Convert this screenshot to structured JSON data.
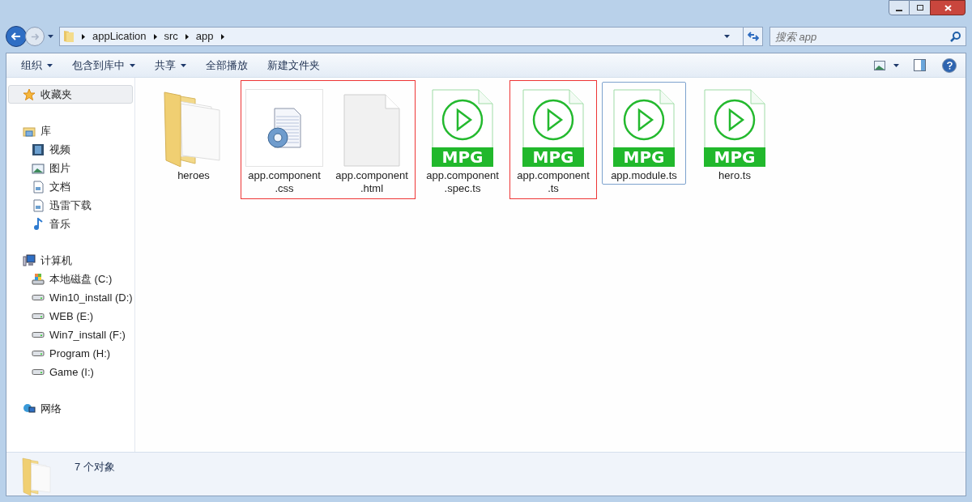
{
  "address_bar": {
    "crumbs": [
      "appLication",
      "src",
      "app"
    ]
  },
  "search": {
    "placeholder": "搜索 app"
  },
  "toolbar": {
    "items": [
      {
        "label": "组织",
        "dropdown": true
      },
      {
        "label": "包含到库中",
        "dropdown": true
      },
      {
        "label": "共享",
        "dropdown": true
      },
      {
        "label": "全部播放",
        "dropdown": false
      },
      {
        "label": "新建文件夹",
        "dropdown": false
      }
    ]
  },
  "sidebar": {
    "sections": [
      {
        "label": "收藏夹",
        "kind": "star",
        "selected": true
      },
      {
        "label": "库",
        "kind": "library",
        "selected": false,
        "children": [
          {
            "label": "视频",
            "kind": "video",
            "selected": false
          },
          {
            "label": "图片",
            "kind": "picture",
            "selected": false
          },
          {
            "label": "文档",
            "kind": "document",
            "selected": false
          },
          {
            "label": "迅雷下载",
            "kind": "document",
            "selected": false
          },
          {
            "label": "音乐",
            "kind": "music",
            "selected": false
          }
        ]
      },
      {
        "label": "计算机",
        "kind": "computer",
        "selected": false,
        "children": [
          {
            "label": "本地磁盘 (C:)",
            "kind": "system-drive",
            "selected": false
          },
          {
            "label": "Win10_install (D:)",
            "kind": "drive",
            "selected": false
          },
          {
            "label": "WEB (E:)",
            "kind": "drive",
            "selected": false
          },
          {
            "label": "Win7_install (F:)",
            "kind": "drive",
            "selected": false
          },
          {
            "label": "Program (H:)",
            "kind": "drive",
            "selected": false
          },
          {
            "label": "Game (I:)",
            "kind": "drive",
            "selected": false
          }
        ]
      },
      {
        "label": "网络",
        "kind": "network",
        "selected": false
      }
    ]
  },
  "groups": [
    {
      "annotated": false,
      "files": [
        {
          "name": "heroes",
          "kind": "folder",
          "selected": false
        }
      ]
    },
    {
      "annotated": true,
      "files": [
        {
          "name": "app.component.css",
          "kind": "settings",
          "selected": false
        },
        {
          "name": "app.component.html",
          "kind": "blank",
          "selected": false
        }
      ]
    },
    {
      "annotated": false,
      "files": [
        {
          "name": "app.component.spec.ts",
          "kind": "media",
          "badge": "MPG",
          "selected": false
        }
      ]
    },
    {
      "annotated": true,
      "files": [
        {
          "name": "app.component.ts",
          "kind": "media",
          "badge": "MPG",
          "selected": false
        }
      ]
    },
    {
      "annotated": false,
      "files": [
        {
          "name": "app.module.ts",
          "kind": "media",
          "badge": "MPG",
          "selected": true
        }
      ]
    },
    {
      "annotated": false,
      "files": [
        {
          "name": "hero.ts",
          "kind": "media",
          "badge": "MPG",
          "selected": false
        }
      ]
    }
  ],
  "status_bar": {
    "text": "7 个对象"
  }
}
